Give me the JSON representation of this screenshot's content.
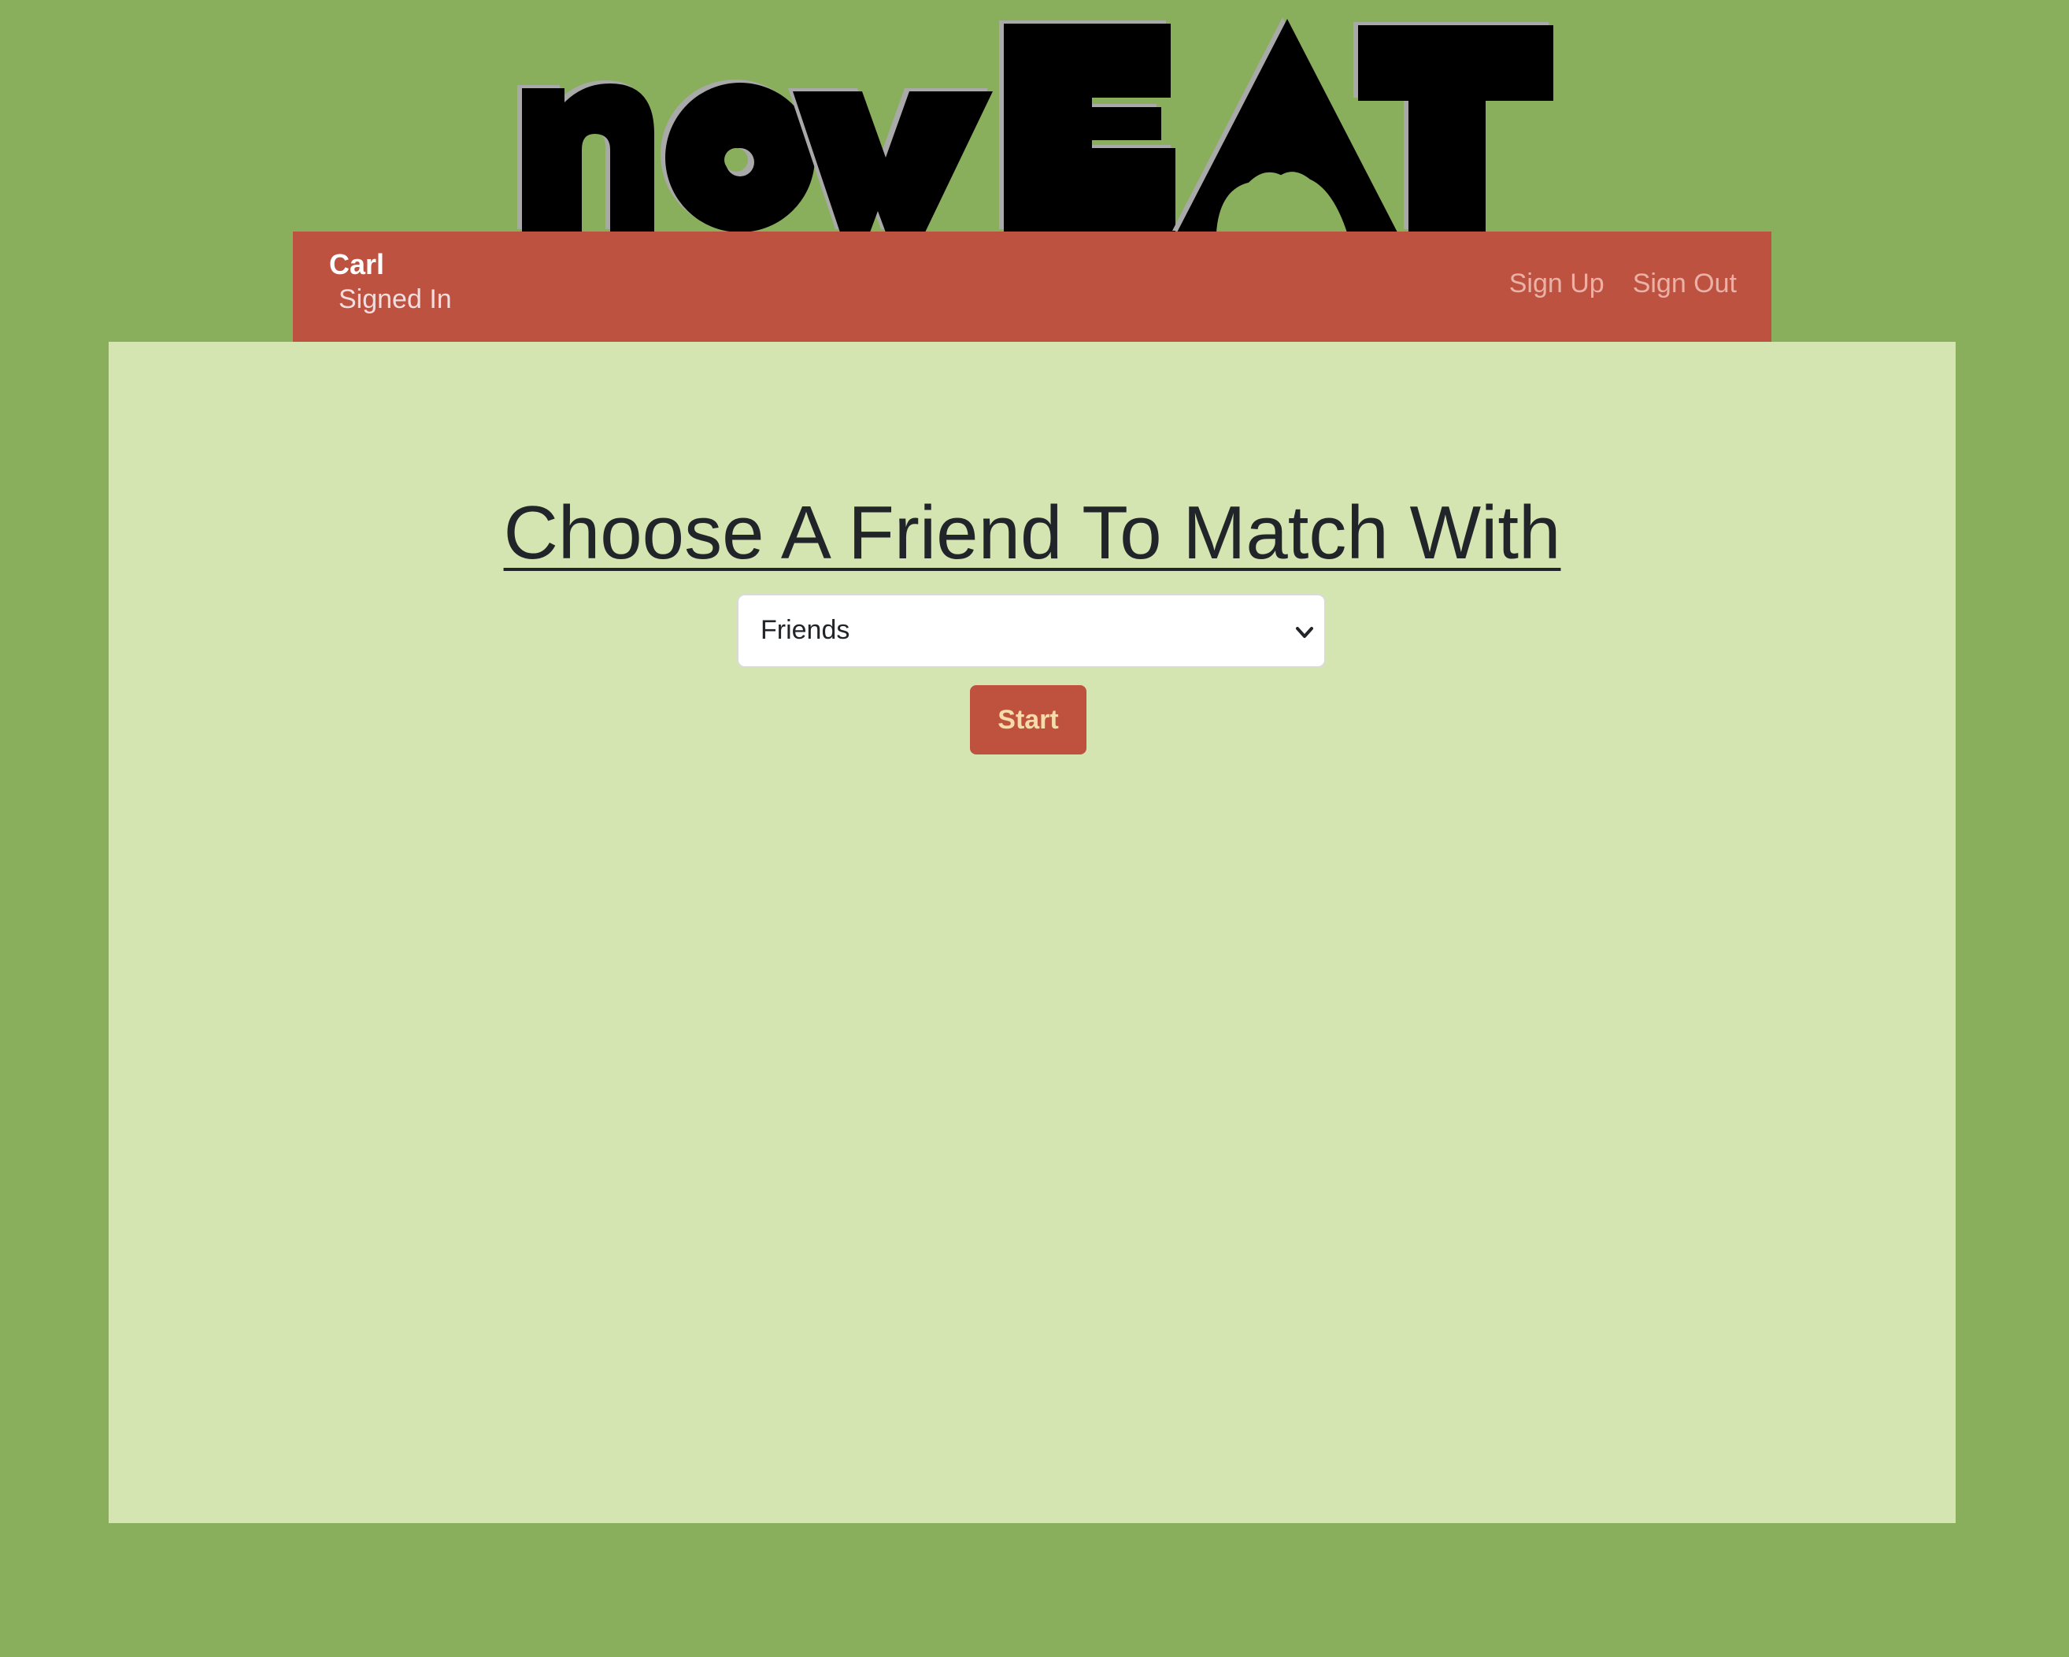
{
  "theme": {
    "page_background": "#8aaf5c",
    "navbar_background": "#be5240",
    "content_background": "#d4e5b2",
    "button_background": "#bf513f",
    "button_text": "#f6dca8",
    "logo_fill": "#000000",
    "logo_outline": "#a9a9a9"
  },
  "logo": {
    "text": "nowEAT"
  },
  "navbar": {
    "user_name": "Carl",
    "user_status": "Signed In",
    "links": [
      {
        "label": "Sign Up"
      },
      {
        "label": "Sign Out"
      }
    ]
  },
  "main": {
    "heading": "Choose A Friend To Match With",
    "friend_select": {
      "selected_value": "Friends",
      "chevron_icon": "chevron-down-icon"
    },
    "start_button_label": "Start"
  }
}
